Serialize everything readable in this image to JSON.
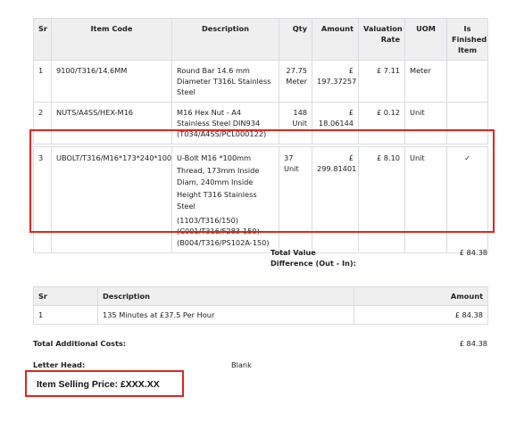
{
  "items_table": {
    "headers": {
      "sr": "Sr",
      "item_code": "Item Code",
      "description": "Description",
      "qty": "Qty",
      "amount": "Amount",
      "valuation_rate": "Valuation Rate",
      "uom": "UOM",
      "is_finished_item": "Is Finished Item"
    },
    "rows": [
      {
        "sr": "1",
        "item_code": "9100/T316/14.6MM",
        "description": "Round Bar 14.6 mm Diameter T316L Stainless Steel",
        "qty": "27.75 Meter",
        "amount": "£ 197.37257",
        "valuation_rate": "£ 7.11",
        "uom": "Meter",
        "is_finished_item": ""
      },
      {
        "sr": "2",
        "item_code": "NUTS/A4SS/HEX-M16",
        "description": "M16 Hex Nut - A4 Stainless Steel DIN934 (T034/A4SS/PCL000122)",
        "qty": "148 Unit",
        "amount": "£ 18.06144",
        "valuation_rate": "£ 0.12",
        "uom": "Unit",
        "is_finished_item": ""
      },
      {
        "sr": "3",
        "item_code": "UBOLT/T316/M16*173*240*100",
        "description": "U-Bolt M16 *100mm Thread, 173mm Inside Diam, 240mm Inside Height T316 Stainless Steel",
        "description_lines": [
          "(1103/T316/150)",
          "(C001/T316/F283-150)",
          "(B004/T316/PS102A-150)"
        ],
        "qty": "37 Unit",
        "amount": "£ 299.81401",
        "valuation_rate": "£ 8.10",
        "uom": "Unit",
        "is_finished_item": "✓"
      }
    ]
  },
  "total_value_difference": {
    "label": "Total Value Difference (Out - In):",
    "value": "£ 84.38"
  },
  "additional_costs_table": {
    "headers": {
      "sr": "Sr",
      "description": "Description",
      "amount": "Amount"
    },
    "rows": [
      {
        "sr": "1",
        "description": "135 Minutes at £37.5 Per Hour",
        "amount": "£ 84.38"
      }
    ]
  },
  "total_additional_costs": {
    "label": "Total Additional Costs:",
    "value": "£ 84.38"
  },
  "letter_head": {
    "label": "Letter Head:",
    "value": "Blank"
  },
  "item_selling_price": {
    "text": "Item Selling Price: £XXX.XX"
  },
  "highlight_color": "#e2261c"
}
